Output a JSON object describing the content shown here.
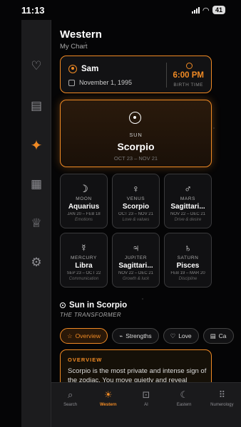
{
  "status": {
    "time": "11:13",
    "battery": "41"
  },
  "header": {
    "title": "Western",
    "subtitle": "My Chart"
  },
  "sidebar": {
    "items": [
      {
        "icon": "heart-icon",
        "glyph": "♡"
      },
      {
        "icon": "briefcase-icon",
        "glyph": "▤"
      },
      {
        "icon": "sparkles-icon",
        "glyph": "✦"
      },
      {
        "icon": "calendar-icon",
        "glyph": "▦"
      },
      {
        "icon": "trophy-icon",
        "glyph": "♕"
      },
      {
        "icon": "settings-icon",
        "glyph": "⚙"
      }
    ],
    "active_index": 2
  },
  "profile": {
    "name": "Sam",
    "birth_date": "November 1, 1995",
    "birth_time": "6:00 PM",
    "birth_time_label": "BIRTH TIME"
  },
  "sun": {
    "label": "SUN",
    "sign": "Scorpio",
    "range": "OCT 23 – NOV 21"
  },
  "planets": [
    {
      "symbol": "☽",
      "name": "MOON",
      "sign": "Aquarius",
      "range": "JAN 20 – FEB 18",
      "desc": "Emotions"
    },
    {
      "symbol": "♀",
      "name": "VENUS",
      "sign": "Scorpio",
      "range": "OCT 23 – NOV 21",
      "desc": "Love & values"
    },
    {
      "symbol": "♂",
      "name": "MARS",
      "sign": "Sagittari...",
      "range": "NOV 22 – DEC 21",
      "desc": "Drive & desire"
    },
    {
      "symbol": "☿",
      "name": "MERCURY",
      "sign": "Libra",
      "range": "SEP 23 – OCT 22",
      "desc": "Communication"
    },
    {
      "symbol": "♃",
      "name": "JUPITER",
      "sign": "Sagittari...",
      "range": "NOV 22 – DEC 21",
      "desc": "Growth & luck"
    },
    {
      "symbol": "♄",
      "name": "SATURN",
      "sign": "Pisces",
      "range": "FEB 19 – MAR 20",
      "desc": "Discipline"
    }
  ],
  "section": {
    "title": "Sun in Scorpio",
    "subtitle": "THE TRANSFORMER"
  },
  "tabs": [
    {
      "label": "Overview",
      "glyph": "☆",
      "active": true
    },
    {
      "label": "Strengths",
      "glyph": "⌁",
      "active": false
    },
    {
      "label": "Love",
      "glyph": "♡",
      "active": false
    },
    {
      "label": "Ca",
      "glyph": "▤",
      "active": false
    }
  ],
  "overview": {
    "label": "OVERVIEW",
    "text": "Scorpio is the most private and intense sign of the zodiac. You move quietly and reveal"
  },
  "bottom_nav": [
    {
      "label": "Search",
      "icon": "search-icon",
      "glyph": "⌕",
      "active": false
    },
    {
      "label": "Western",
      "icon": "sun-cloud-icon",
      "glyph": "☀",
      "active": true
    },
    {
      "label": "AI",
      "icon": "chip-icon",
      "glyph": "⊡",
      "active": false
    },
    {
      "label": "Eastern",
      "icon": "moon-icon",
      "glyph": "☾",
      "active": false
    },
    {
      "label": "Numerology",
      "icon": "grid-icon",
      "glyph": "⠿",
      "active": false
    }
  ],
  "colors": {
    "accent": "#f08a24",
    "background": "#050506",
    "card": "#111113"
  }
}
